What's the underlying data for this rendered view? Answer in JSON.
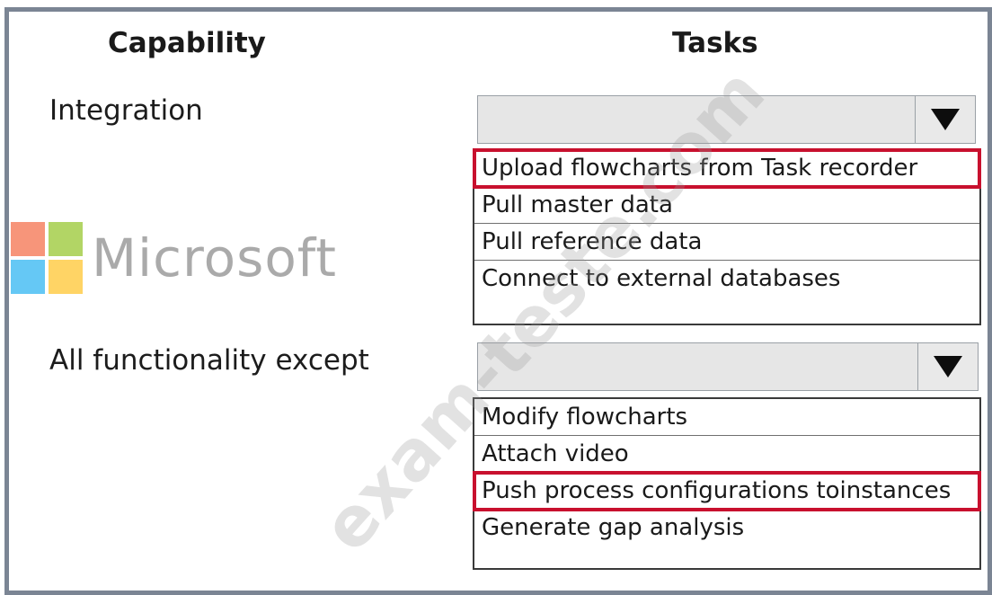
{
  "headers": {
    "capability": "Capability",
    "tasks": "Tasks"
  },
  "rows": [
    {
      "capability": "Integration",
      "selected_value": "",
      "options": [
        "Upload flowcharts from Task recorder",
        "Pull master data",
        "Pull reference data",
        "Connect to external databases"
      ],
      "highlighted_option": "Upload flowcharts from Task recorder"
    },
    {
      "capability": "All functionality except",
      "selected_value": "",
      "options": [
        "Modify flowcharts",
        "Attach video",
        "Push process configurations toinstances",
        "Generate gap analysis"
      ],
      "highlighted_option": "Push process configurations toinstances"
    }
  ],
  "logo": {
    "text": "Microsoft"
  },
  "watermark": {
    "text": "exam-teste.com"
  },
  "colors": {
    "highlight": "#c8102e",
    "frame": "#7b8594",
    "dropdown_bg": "#e6e6e6"
  },
  "icons": {
    "dropdown_arrow": "chevron-down-icon"
  }
}
